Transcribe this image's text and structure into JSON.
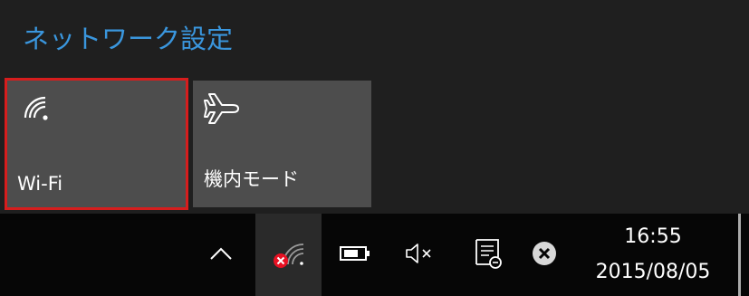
{
  "panel": {
    "settings_link": "ネットワーク設定",
    "tiles": [
      {
        "label": "Wi-Fi",
        "icon": "wifi-icon",
        "selected": true
      },
      {
        "label": "機内モード",
        "icon": "airplane-icon",
        "selected": false
      }
    ]
  },
  "taskbar": {
    "icons": [
      "chevron-up-icon",
      "network-disconnected-icon",
      "battery-icon",
      "volume-muted-icon",
      "notification-center-icon",
      "close-circle-icon"
    ],
    "time": "16:55",
    "date": "2015/08/05"
  },
  "colors": {
    "accent": "#3a96dd",
    "selection_border": "#d61d1d",
    "tile_bg": "#4d4d4d",
    "error_badge": "#e81123"
  }
}
